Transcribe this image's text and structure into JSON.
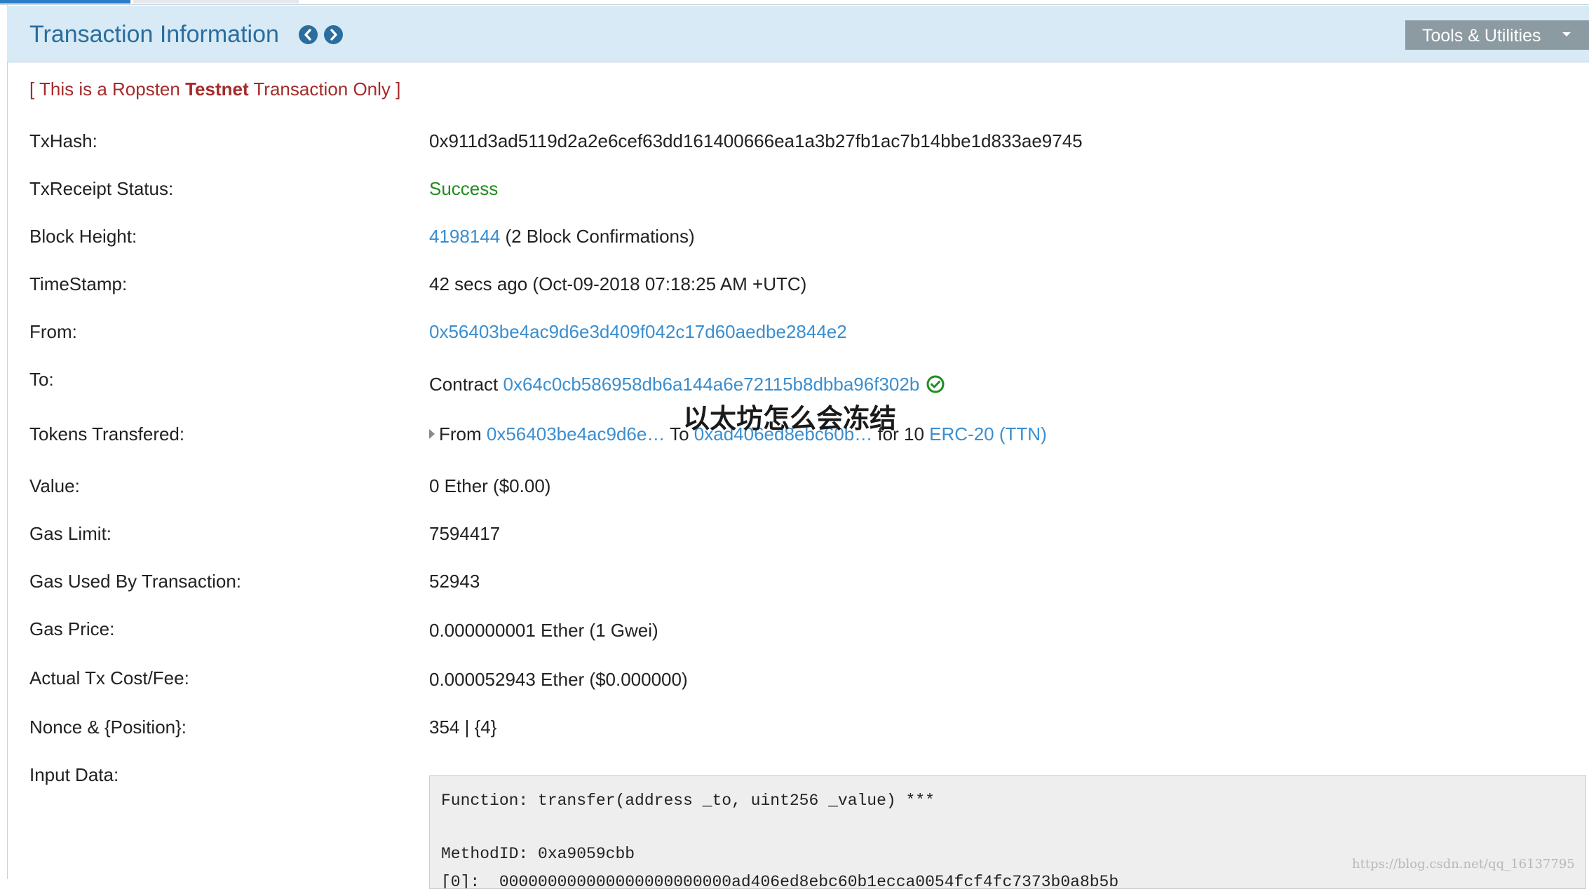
{
  "header": {
    "title": "Transaction Information",
    "tools_label": "Tools & Utilities"
  },
  "notice": {
    "prefix": "[ This is a Ropsten ",
    "bold": "Testnet",
    "suffix": " Transaction Only ]"
  },
  "fields": {
    "txhash": {
      "label": "TxHash:",
      "value": "0x911d3ad5119d2a2e6cef63dd161400666ea1a3b27fb1ac7b14bbe1d833ae9745"
    },
    "status": {
      "label": "TxReceipt Status:",
      "value": "Success"
    },
    "block": {
      "label": "Block Height:",
      "link": "4198144",
      "text": " (2 Block Confirmations)"
    },
    "timestamp": {
      "label": "TimeStamp:",
      "value": "42 secs ago (Oct-09-2018 07:18:25 AM +UTC)"
    },
    "from": {
      "label": "From:",
      "value": "0x56403be4ac9d6e3d409f042c17d60aedbe2844e2"
    },
    "to": {
      "label": "To:",
      "prefix": "Contract ",
      "link": "0x64c0cb586958db6a144a6e72115b8dbba96f302b"
    },
    "tokens": {
      "label": "Tokens Transfered:",
      "from_word": "From ",
      "from_link": "0x56403be4ac9d6e…",
      "to_word": " To ",
      "to_link": "0xad406ed8ebc60b…",
      "for_word": " for  10 ",
      "token_link": "ERC-20 (TTN)"
    },
    "value": {
      "label": "Value:",
      "value": "0 Ether ($0.00)"
    },
    "gas_limit": {
      "label": "Gas Limit:",
      "value": "7594417"
    },
    "gas_used": {
      "label": "Gas Used By Transaction:",
      "value": "52943"
    },
    "gas_price": {
      "label": "Gas Price:",
      "value": "0.000000001 Ether (1 Gwei)"
    },
    "tx_cost": {
      "label": "Actual Tx Cost/Fee:",
      "value": "0.000052943 Ether ($0.000000)"
    },
    "nonce": {
      "label": "Nonce & {Position}:",
      "value": "354 | {4}"
    },
    "input": {
      "label": "Input Data:",
      "function_line": "Function: transfer(address _to, uint256 _value) ***",
      "method_line": "MethodID: 0xa9059cbb",
      "param_line": "[0]:  000000000000000000000000ad406ed8ebc60b1ecca0054fcf4fc7373b0a8b5b"
    }
  },
  "overlay_text": "以太坊怎么会冻结",
  "watermark": "https://blog.csdn.net/qq_16137795",
  "icons": {
    "prev": "chevron-left-circle-icon",
    "next": "chevron-right-circle-icon",
    "dropdown": "caret-down-icon",
    "verified": "check-circle-icon",
    "expand": "caret-right-icon"
  },
  "colors": {
    "header_bg": "#d7eaf5",
    "title": "#2a6d9e",
    "notice": "#a52a2a",
    "link": "#3a8ed0",
    "success": "#208c20",
    "tools_bg": "#8c9aa1"
  }
}
